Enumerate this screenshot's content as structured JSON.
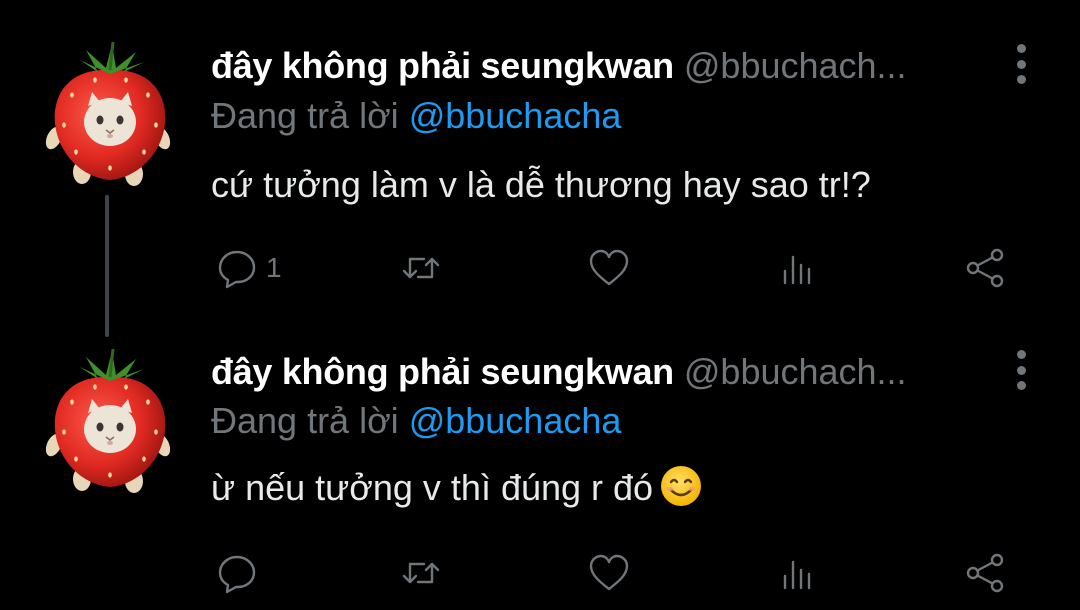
{
  "thread": [
    {
      "author": {
        "display_name": "đây không phải seungkwan",
        "handle": "@bbuchach..."
      },
      "reply_prefix": "Đang trả lời",
      "reply_target": "@bbuchacha",
      "text": "cứ tưởng làm v là dễ thương hay sao tr!?",
      "emoji": "",
      "reply_count": "1",
      "has_thread_line": true
    },
    {
      "author": {
        "display_name": "đây không phải seungkwan",
        "handle": "@bbuchach..."
      },
      "reply_prefix": "Đang trả lời",
      "reply_target": "@bbuchacha",
      "text": "ừ nếu tưởng v thì đúng r đó",
      "emoji": "smiling-face-icon",
      "reply_count": "",
      "has_thread_line": false
    }
  ],
  "colors": {
    "background": "#000000",
    "primary_text": "#e7e9ea",
    "secondary_text": "#71767b",
    "link": "#1d9bf0",
    "thread_line": "#3f4448"
  },
  "icons": {
    "more": "more-vertical-icon",
    "reply": "comment-icon",
    "retweet": "retweet-icon",
    "like": "heart-icon",
    "stats": "analytics-icon",
    "share": "share-icon",
    "avatar": "strawberry-cat-avatar"
  }
}
